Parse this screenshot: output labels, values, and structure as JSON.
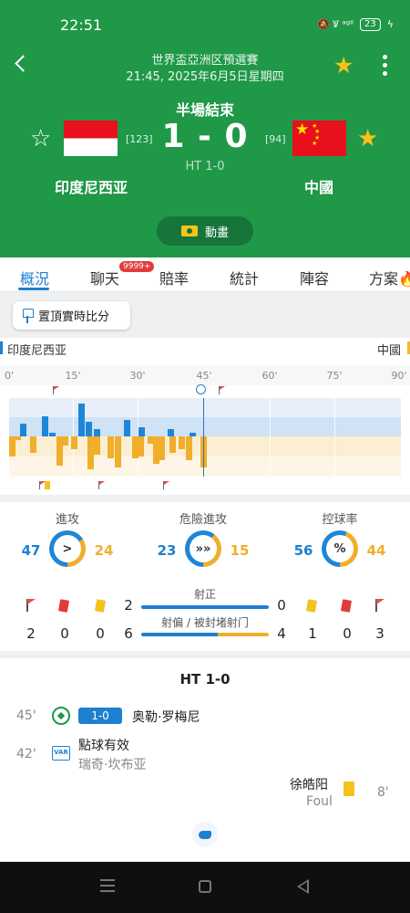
{
  "status_bar": {
    "time": "22:51",
    "icons": "🔕 Ꝟ ᵃᵍⁱˡ",
    "battery": "23",
    "charging": "ϟ"
  },
  "header": {
    "league": "世界盃亞洲区預選賽",
    "datetime": "21:45, 2025年6月5日星期四",
    "status": "半場結束",
    "score": "1 - 0",
    "half_time": "HT 1-0",
    "animation_label": "動畫"
  },
  "home": {
    "name": "印度尼西亚",
    "rank": "[123]",
    "color": "#1d86d8"
  },
  "away": {
    "name": "中國",
    "rank": "[94]",
    "color": "#f0ae2a"
  },
  "tabs": [
    {
      "label": "概況",
      "active": true
    },
    {
      "label": "聊天",
      "badge": "9999+"
    },
    {
      "label": "賠率"
    },
    {
      "label": "統計"
    },
    {
      "label": "陣容"
    },
    {
      "label": "方案"
    }
  ],
  "pin_label": "置頂實時比分",
  "momentum": {
    "home_label": "印度尼西亚",
    "away_label": "中國",
    "minutes": [
      "0'",
      "15'",
      "30'",
      "45'",
      "60'",
      "75'",
      "90'"
    ]
  },
  "stats": {
    "attacks": {
      "title": "進攻",
      "home": "47",
      "away": "24",
      "home_share": 0.662
    },
    "dangerous": {
      "title": "危險進攻",
      "home": "23",
      "away": "15",
      "home_share": 0.605
    },
    "possession": {
      "title": "控球率",
      "home": "56",
      "away": "44",
      "home_share": 0.56,
      "symbol": "%"
    },
    "shots_on": {
      "title": "射正",
      "home": "2",
      "away": "0"
    },
    "shots_off": {
      "title": "射偏 / 被封堵射门",
      "home": "6",
      "away": "4"
    },
    "home_counts": {
      "corners": "2",
      "red": "0",
      "yellow": "0"
    },
    "away_counts": {
      "yellow": "1",
      "red": "0",
      "corners": "3"
    }
  },
  "timeline": {
    "title": "HT 1-0",
    "events": [
      {
        "minute": "45'",
        "score": "1-0",
        "player": "奥勒·罗梅尼"
      },
      {
        "minute": "42'",
        "text": "點球有效",
        "player": "瑞奇·坎布亚"
      },
      {
        "minute": "8'",
        "player": "徐皓阳",
        "note": "Foul"
      }
    ]
  }
}
